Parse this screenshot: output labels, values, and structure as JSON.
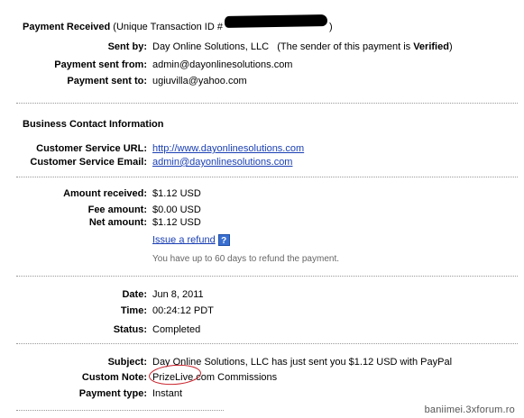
{
  "header": {
    "title": "Payment Received",
    "transaction_prefix": "(Unique Transaction ID #",
    "transaction_suffix": ")"
  },
  "sender": {
    "sent_by_label": "Sent by:",
    "sent_by_value": "Day Online Solutions, LLC",
    "verified_prefix": "(The sender of this payment is ",
    "verified_word": "Verified",
    "verified_suffix": ")",
    "sent_from_label": "Payment sent from:",
    "sent_from_value": "admin@dayonlinesolutions.com",
    "sent_to_label": "Payment sent to:",
    "sent_to_value": "ugiuvilla@yahoo.com"
  },
  "business": {
    "heading": "Business Contact Information",
    "url_label": "Customer Service URL:",
    "url_value": "http://www.dayonlinesolutions.com",
    "email_label": "Customer Service Email:",
    "email_value": "admin@dayonlinesolutions.com"
  },
  "amounts": {
    "received_label": "Amount received:",
    "received_value": "$1.12 USD",
    "fee_label": "Fee amount:",
    "fee_value": "$0.00 USD",
    "net_label": "Net amount:",
    "net_value": "$1.12 USD",
    "refund_link": "Issue a refund",
    "help_glyph": "?",
    "refund_note": "You have up to 60 days to refund the payment."
  },
  "details": {
    "date_label": "Date:",
    "date_value": "Jun 8, 2011",
    "time_label": "Time:",
    "time_value": "00:24:12 PDT",
    "status_label": "Status:",
    "status_value": "Completed"
  },
  "message": {
    "subject_label": "Subject:",
    "subject_value": "Day Online Solutions, LLC has just sent you $1.12 USD with PayPal",
    "note_label": "Custom Note:",
    "note_value": "PrizeLive.com Commissions",
    "type_label": "Payment type:",
    "type_value": "Instant"
  },
  "watermark": "baniimei.3xforum.ro",
  "colors": {
    "link": "#1a3fb4",
    "annotation_circle": "#c8202a",
    "divider": "#999999"
  }
}
